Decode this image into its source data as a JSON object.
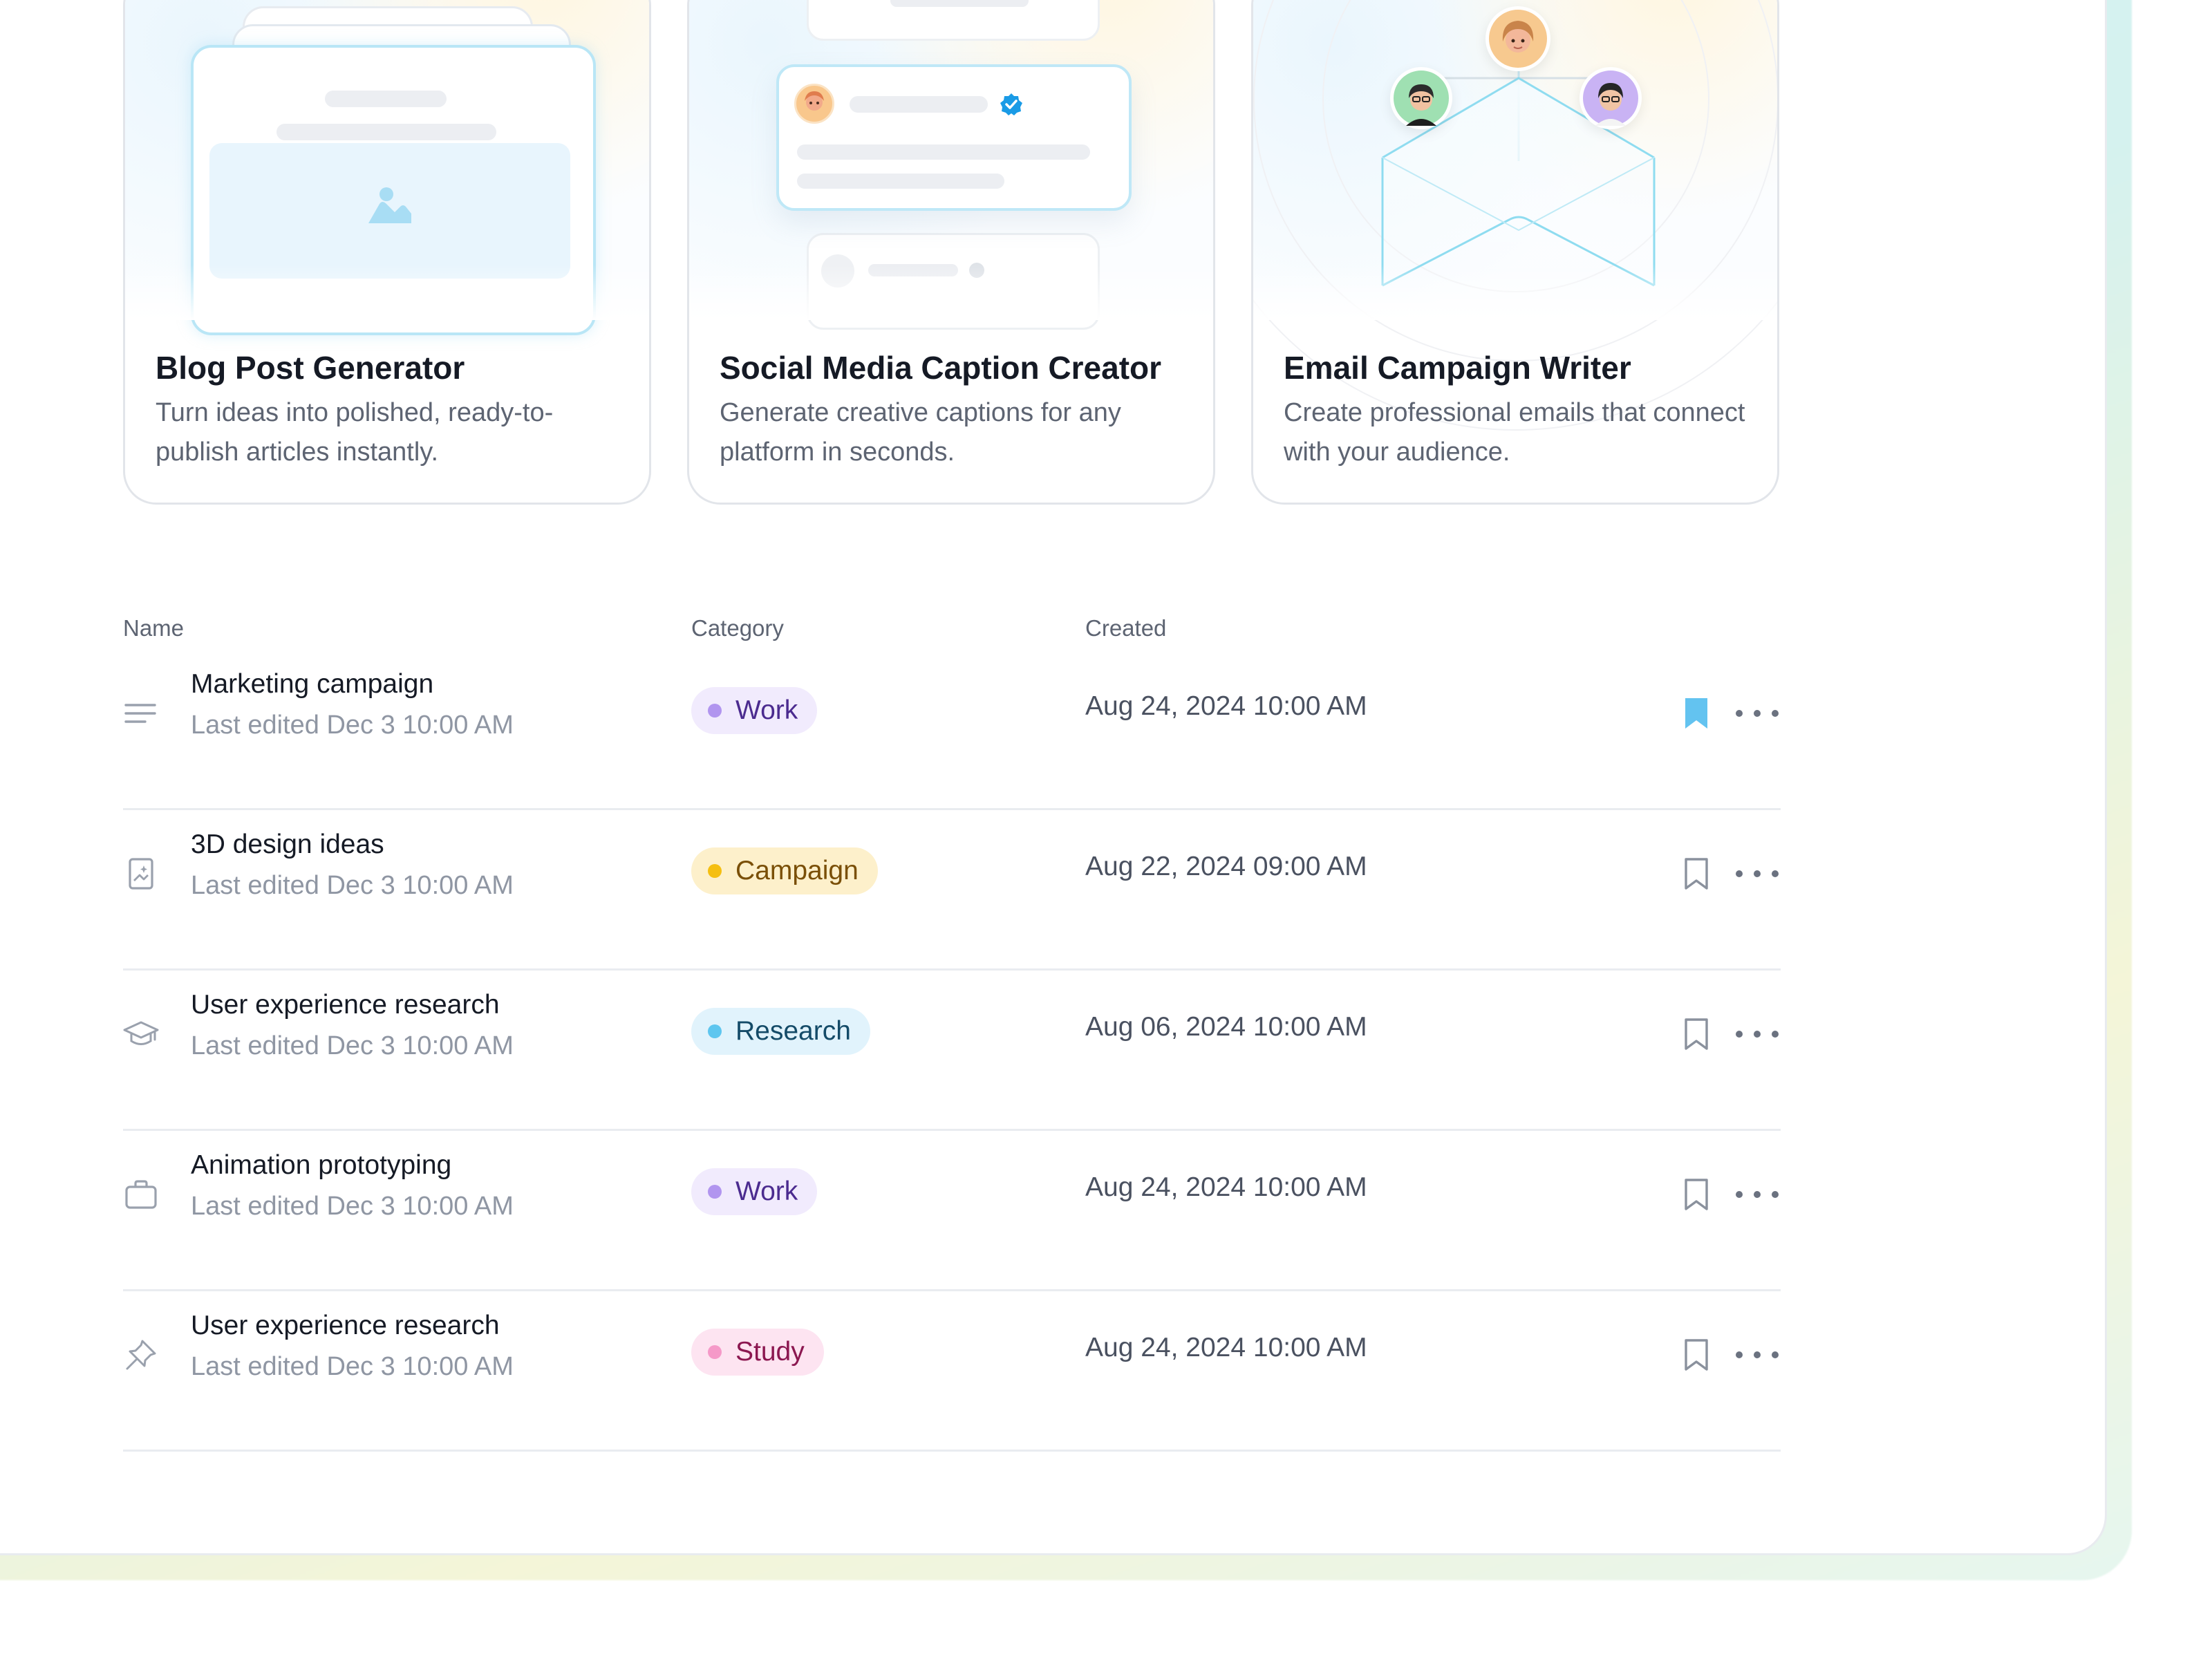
{
  "cards": [
    {
      "title": "Blog Post Generator",
      "description": "Turn ideas into polished, ready-to-publish articles instantly."
    },
    {
      "title": "Social Media Caption Creator",
      "description": "Generate creative captions for any platform in seconds."
    },
    {
      "title": "Email Campaign Writer",
      "description": "Create professional emails that connect with your audience."
    }
  ],
  "table": {
    "headers": {
      "name": "Name",
      "category": "Category",
      "created": "Created"
    },
    "rows": [
      {
        "icon": "text-lines-icon",
        "name": "Marketing campaign",
        "subtitle": "Last edited Dec 3 10:00 AM",
        "category": "Work",
        "category_color": "#b195ef",
        "created": "Aug 24, 2024 10:00 AM",
        "bookmarked": true
      },
      {
        "icon": "image-file-icon",
        "name": "3D design ideas",
        "subtitle": "Last edited Dec 3 10:00 AM",
        "category": "Campaign",
        "category_color": "#f5bf11",
        "created": "Aug 22, 2024 09:00 AM",
        "bookmarked": false
      },
      {
        "icon": "graduation-cap-icon",
        "name": "User experience research",
        "subtitle": "Last edited Dec 3 10:00 AM",
        "category": "Research",
        "category_color": "#5ec6ef",
        "created": "Aug 06, 2024 10:00 AM",
        "bookmarked": false
      },
      {
        "icon": "briefcase-icon",
        "name": "Animation prototyping",
        "subtitle": "Last edited Dec 3 10:00 AM",
        "category": "Work",
        "category_color": "#b195ef",
        "created": "Aug 24, 2024 10:00 AM",
        "bookmarked": false
      },
      {
        "icon": "pin-icon",
        "name": "User experience research",
        "subtitle": "Last edited Dec 3 10:00 AM",
        "category": "Study",
        "category_color": "#f599c8",
        "created": "Aug 24, 2024 10:00 AM",
        "bookmarked": false
      }
    ]
  },
  "colors": {
    "accent": "#5ec6ef",
    "bookmark_active": "#63c3f0"
  }
}
